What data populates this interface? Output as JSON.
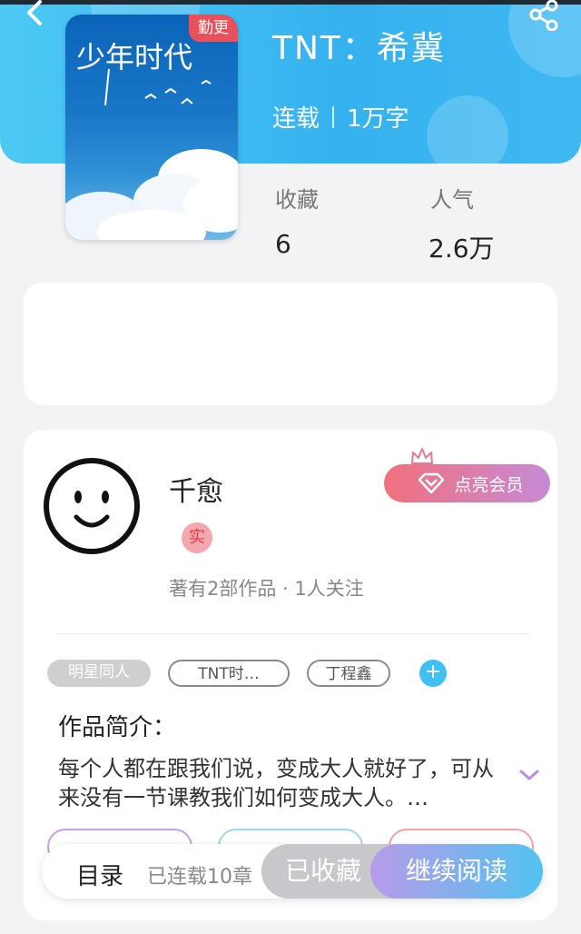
{
  "colors": {
    "header_blue": "#3fb8f2",
    "badge_red": "#e8505b",
    "vip_gradient": [
      "#f0707c",
      "#c78ad6"
    ],
    "tag_add": "#3fbff2",
    "continue_gradient": [
      "#b79be8",
      "#52c3f1"
    ]
  },
  "header": {
    "back_icon": "chevron-left-icon",
    "share_icon": "share-icon"
  },
  "book": {
    "cover_text": "少年时代",
    "badge": "勤更",
    "title": "TNT：希冀",
    "status": "连载",
    "word_count": "1万字",
    "stats": [
      {
        "label": "收藏",
        "value": "6"
      },
      {
        "label": "人气",
        "value": "2.6万"
      }
    ]
  },
  "author": {
    "name": "千愈",
    "verified_badge": "实",
    "meta": "著有2部作品 · 1人关注",
    "vip_button": "点亮会员",
    "vip_icon": "diamond-icon"
  },
  "tags": [
    "明星同人",
    "TNT时…",
    "丁程鑫"
  ],
  "intro": {
    "title": "作品简介：",
    "text": "每个人都在跟我们说，变成大人就好了，可从来没有一节课教我们如何变成大人。…"
  },
  "bottom_bar": {
    "toc_label": "目录",
    "chapters": "已连载10章",
    "collected": "已收藏",
    "continue": "继续阅读"
  }
}
